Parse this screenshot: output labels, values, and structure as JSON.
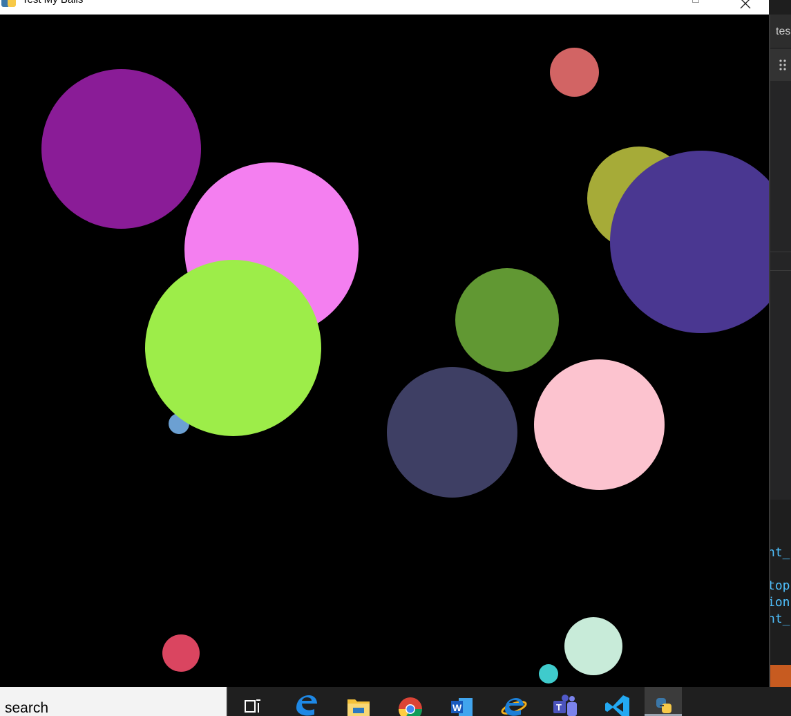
{
  "window": {
    "title": "Test My Balls"
  },
  "canvas": {
    "background": "#000000",
    "balls": [
      {
        "name": "ball-purple",
        "color": "#8a1c97"
      },
      {
        "name": "ball-red-top",
        "color": "#d26464"
      },
      {
        "name": "ball-olive",
        "color": "#a6ab38"
      },
      {
        "name": "ball-pink",
        "color": "#f47ff0"
      },
      {
        "name": "ball-blue-small",
        "color": "#6ca0d2"
      },
      {
        "name": "ball-lime",
        "color": "#9ded49"
      },
      {
        "name": "ball-indigo",
        "color": "#4a3791"
      },
      {
        "name": "ball-green",
        "color": "#619833"
      },
      {
        "name": "ball-slate",
        "color": "#3e3f64"
      },
      {
        "name": "ball-light-pink",
        "color": "#fcc3cf"
      },
      {
        "name": "ball-crimson",
        "color": "#da4560"
      },
      {
        "name": "ball-mint",
        "color": "#c8ebd9"
      },
      {
        "name": "ball-cyan",
        "color": "#3fcbcc"
      }
    ]
  },
  "editor": {
    "tab_label": "tes",
    "code_lines": [
      "nt_",
      "top",
      "ion",
      "nt_"
    ]
  },
  "taskbar": {
    "search_placeholder": "search",
    "apps": [
      {
        "name": "task-view-icon"
      },
      {
        "name": "edge-icon"
      },
      {
        "name": "file-explorer-icon"
      },
      {
        "name": "chrome-icon"
      },
      {
        "name": "word-icon"
      },
      {
        "name": "internet-explorer-icon"
      },
      {
        "name": "teams-icon"
      },
      {
        "name": "vscode-icon"
      },
      {
        "name": "python-icon"
      }
    ]
  }
}
